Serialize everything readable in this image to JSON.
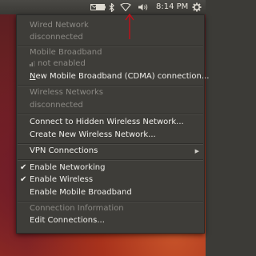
{
  "panel": {
    "clock": "8:14 PM"
  },
  "menu": {
    "wired_header": "Wired Network",
    "wired_status": "disconnected",
    "mobile_header": "Mobile Broadband",
    "mobile_status": "not enabled",
    "mobile_new": "New Mobile Broadband (CDMA) connection...",
    "wireless_header": "Wireless Networks",
    "wireless_status": "disconnected",
    "connect_hidden": "Connect to Hidden Wireless Network...",
    "create_new": "Create New Wireless Network...",
    "vpn": "VPN Connections",
    "enable_networking": "Enable Networking",
    "enable_wireless": "Enable Wireless",
    "enable_mobile": "Enable Mobile Broadband",
    "conn_info": "Connection Information",
    "edit_conn": "Edit Connections..."
  },
  "colors": {
    "arrow": "#c0101a"
  }
}
